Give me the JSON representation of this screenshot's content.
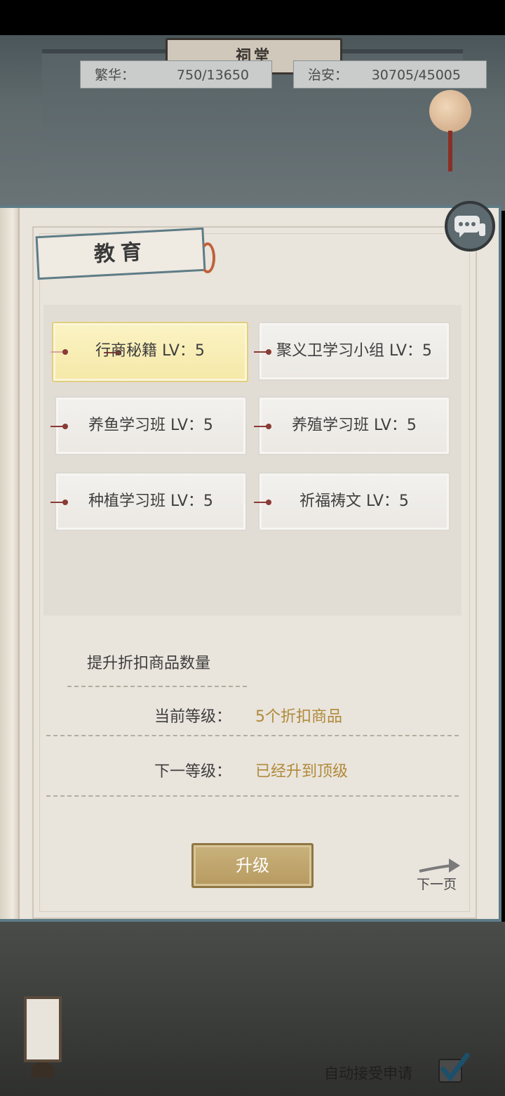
{
  "header": {
    "plaque_text": "祠堂",
    "prosperity": {
      "label": "繁华：",
      "value": "750/13650"
    },
    "security": {
      "label": "治安：",
      "value": "30705/45005"
    }
  },
  "panel": {
    "title": "教育"
  },
  "skills": [
    {
      "label": "行商秘籍 LV：5",
      "selected": true
    },
    {
      "label": "聚义卫学习小组 LV：5",
      "selected": false
    },
    {
      "label": "养鱼学习班 LV：5",
      "selected": false
    },
    {
      "label": "养殖学习班 LV：5",
      "selected": false
    },
    {
      "label": "种植学习班 LV：5",
      "selected": false
    },
    {
      "label": "祈福祷文 LV：5",
      "selected": false
    }
  ],
  "detail": {
    "description": "提升折扣商品数量",
    "current_label": "当前等级：",
    "current_value": "5个折扣商品",
    "next_label": "下一等级：",
    "next_value": "已经升到顶级"
  },
  "actions": {
    "upgrade_label": "升级",
    "next_page_label": "下一页"
  },
  "footer": {
    "auto_accept_label": "自动接受申请",
    "auto_accept_checked": true
  },
  "icons": [
    "chat-icon",
    "next-arrow-icon",
    "checkmark-icon",
    "lantern-icon"
  ],
  "colors": {
    "accent_gold": "#b08a3a",
    "frame_blue": "#5e7c86",
    "selected_card": "#f5e8a8"
  }
}
